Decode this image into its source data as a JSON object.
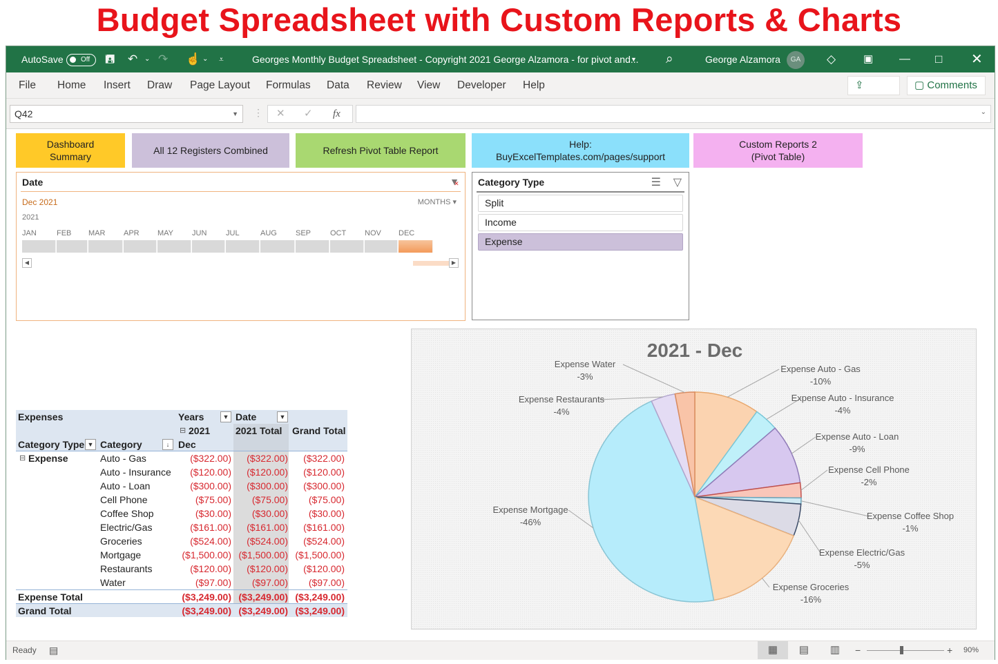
{
  "banner": {
    "title": "Budget Spreadsheet with Custom Reports & Charts"
  },
  "titlebar": {
    "autosave_label": "AutoSave",
    "autosave_state": "Off",
    "document_title": "Georges Monthly Budget Spreadsheet - Copyright 2021 George Alzamora - for pivot and...",
    "user_name": "George Alzamora",
    "user_initials": "GA",
    "icons": [
      "save-icon",
      "undo-icon",
      "redo-icon",
      "touch-mode-icon",
      "customize-qat-icon",
      "search-icon",
      "premium-diamond-icon",
      "ribbon-display-icon",
      "minimize-icon",
      "maximize-icon",
      "close-icon"
    ]
  },
  "menu": {
    "items": [
      "File",
      "Home",
      "Insert",
      "Draw",
      "Page Layout",
      "Formulas",
      "Data",
      "Review",
      "View",
      "Developer",
      "Help"
    ],
    "share_label": "Share",
    "comments_label": "Comments"
  },
  "formula_bar": {
    "name_box": "Q42",
    "formula": "",
    "fx_label": "fx"
  },
  "nav_buttons": [
    {
      "label": "Dashboard Summary",
      "color": "#ffc928"
    },
    {
      "label": "All 12 Registers Combined",
      "color": "#ccc0da"
    },
    {
      "label": "Refresh Pivot Table Report",
      "color": "#a9d871"
    },
    {
      "label": "Help: BuyExcelTemplates.com/pages/support",
      "color": "#8be0fb"
    },
    {
      "label": "Custom Reports 2 (Pivot Table)",
      "color": "#f4b1f0"
    }
  ],
  "nav_lines": {
    "b0": [
      "Dashboard",
      "Summary"
    ],
    "b3": [
      "Help:",
      "BuyExcelTemplates.com/pages/support"
    ],
    "b4": [
      "Custom Reports 2",
      "(Pivot Table)"
    ]
  },
  "date_slicer": {
    "header": "Date",
    "selection": "Dec 2021",
    "level": "MONTHS",
    "year": "2021",
    "months": [
      "JAN",
      "FEB",
      "MAR",
      "APR",
      "MAY",
      "JUN",
      "JUL",
      "AUG",
      "SEP",
      "OCT",
      "NOV",
      "DEC"
    ],
    "selected_month": "DEC"
  },
  "category_slicer": {
    "header": "Category Type",
    "items": [
      {
        "label": "Split",
        "selected": false
      },
      {
        "label": "Income",
        "selected": false
      },
      {
        "label": "Expense",
        "selected": true
      }
    ]
  },
  "pivot": {
    "values_label": "Expenses",
    "col_field_years": "Years",
    "col_field_date": "Date",
    "year_label": "2021",
    "month_label": "Dec",
    "year_total_label": "2021 Total",
    "grand_total_label": "Grand Total",
    "row_field_type": "Category Type",
    "row_field_category": "Category",
    "group_label": "Expense",
    "rows": [
      {
        "category": "Auto - Gas",
        "dec": "($322.00)",
        "year_total": "($322.00)",
        "grand_total": "($322.00)"
      },
      {
        "category": "Auto - Insurance",
        "dec": "($120.00)",
        "year_total": "($120.00)",
        "grand_total": "($120.00)"
      },
      {
        "category": "Auto - Loan",
        "dec": "($300.00)",
        "year_total": "($300.00)",
        "grand_total": "($300.00)"
      },
      {
        "category": "Cell Phone",
        "dec": "($75.00)",
        "year_total": "($75.00)",
        "grand_total": "($75.00)"
      },
      {
        "category": "Coffee Shop",
        "dec": "($30.00)",
        "year_total": "($30.00)",
        "grand_total": "($30.00)"
      },
      {
        "category": "Electric/Gas",
        "dec": "($161.00)",
        "year_total": "($161.00)",
        "grand_total": "($161.00)"
      },
      {
        "category": "Groceries",
        "dec": "($524.00)",
        "year_total": "($524.00)",
        "grand_total": "($524.00)"
      },
      {
        "category": "Mortgage",
        "dec": "($1,500.00)",
        "year_total": "($1,500.00)",
        "grand_total": "($1,500.00)"
      },
      {
        "category": "Restaurants",
        "dec": "($120.00)",
        "year_total": "($120.00)",
        "grand_total": "($120.00)"
      },
      {
        "category": "Water",
        "dec": "($97.00)",
        "year_total": "($97.00)",
        "grand_total": "($97.00)"
      }
    ],
    "expense_total": {
      "label": "Expense Total",
      "dec": "($3,249.00)",
      "year_total": "($3,249.00)",
      "grand_total": "($3,249.00)"
    },
    "grand_total": {
      "label": "Grand Total",
      "dec": "($3,249.00)",
      "year_total": "($3,249.00)",
      "grand_total": "($3,249.00)"
    },
    "negative_color": "#d7282f"
  },
  "chart_data": {
    "type": "pie",
    "title": "2021 - Dec",
    "categories": [
      "Expense Auto - Gas",
      "Expense Auto - Insurance",
      "Expense Auto - Loan",
      "Expense Cell Phone",
      "Expense Coffee Shop",
      "Expense Electric/Gas",
      "Expense Groceries",
      "Expense Mortgage",
      "Expense Restaurants",
      "Expense Water"
    ],
    "values": [
      -322,
      -120,
      -300,
      -75,
      -30,
      -161,
      -524,
      -1500,
      -120,
      -97
    ],
    "percent_labels": [
      "-10%",
      "-4%",
      "-9%",
      "-2%",
      "-1%",
      "-5%",
      "-16%",
      "-46%",
      "-4%",
      "-3%"
    ],
    "colors": [
      "#fbd3b0",
      "#bff0f9",
      "#d7c8ef",
      "#f9c6b9",
      "#cfe9f3",
      "#dcdbe6",
      "#fcd9b6",
      "#b6ecfb",
      "#e4dcf4",
      "#f9c4a8"
    ],
    "edge_colors": [
      "#e8a76c",
      "#79c7d8",
      "#8f7bb7",
      "#c0504d",
      "#6aa9bf",
      "#3a4a66",
      "#e8b17f",
      "#88c4d4",
      "#b0a4cc",
      "#d98b5f"
    ],
    "legend": "none (data labels)"
  },
  "statusbar": {
    "status": "Ready",
    "zoom": "90%",
    "zoom_level": 0.9
  }
}
